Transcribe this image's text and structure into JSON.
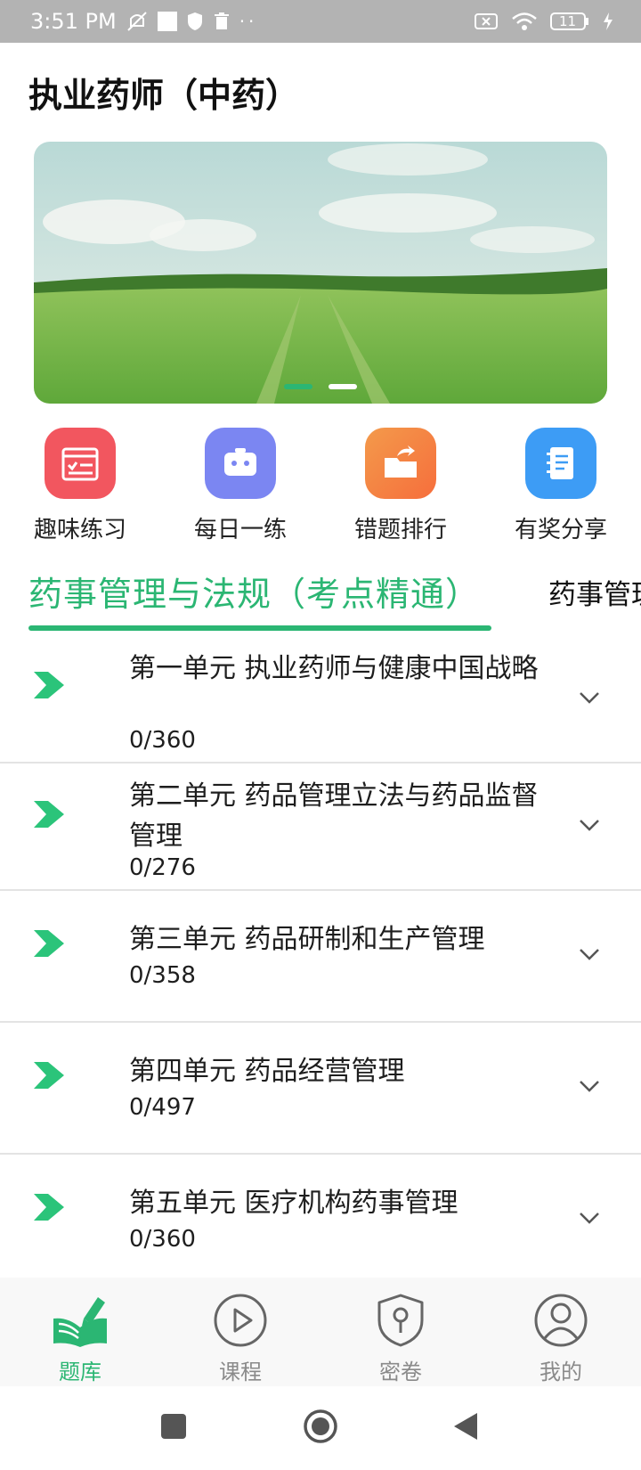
{
  "status_bar": {
    "time": "3:51 PM",
    "battery": "11"
  },
  "header": {
    "title": "执业药师（中药）"
  },
  "banner": {
    "slide_count": 2,
    "active_slide": 1
  },
  "quick_actions": [
    {
      "label": "趣味练习",
      "icon": "checklist-icon",
      "color": "#f2565f"
    },
    {
      "label": "每日一练",
      "icon": "robot-icon",
      "color": "#7b86f2"
    },
    {
      "label": "错题排行",
      "icon": "folder-share-icon",
      "color": "#f6864a"
    },
    {
      "label": "有奖分享",
      "icon": "notebook-icon",
      "color": "#3d9cf5"
    }
  ],
  "tabs": [
    {
      "label": "药事管理与法规（考点精通）",
      "active": true
    },
    {
      "label": "药事管理",
      "active": false
    }
  ],
  "units": [
    {
      "title": "第一单元 执业药师与健康中国战略",
      "count": "0/360"
    },
    {
      "title": "第二单元 药品管理立法与药品监督管理",
      "count": "0/276"
    },
    {
      "title": "第三单元 药品研制和生产管理",
      "count": "0/358"
    },
    {
      "title": "第四单元 药品经营管理",
      "count": "0/497"
    },
    {
      "title": "第五单元 医疗机构药事管理",
      "count": "0/360"
    }
  ],
  "bottom_nav": [
    {
      "label": "题库",
      "icon": "book-pen-icon",
      "active": true
    },
    {
      "label": "课程",
      "icon": "play-circle-icon",
      "active": false
    },
    {
      "label": "密卷",
      "icon": "shield-lock-icon",
      "active": false
    },
    {
      "label": "我的",
      "icon": "user-circle-icon",
      "active": false
    }
  ],
  "colors": {
    "accent": "#2bb673",
    "text": "#1e1e1e",
    "inactive_nav": "#8a8a8a"
  }
}
